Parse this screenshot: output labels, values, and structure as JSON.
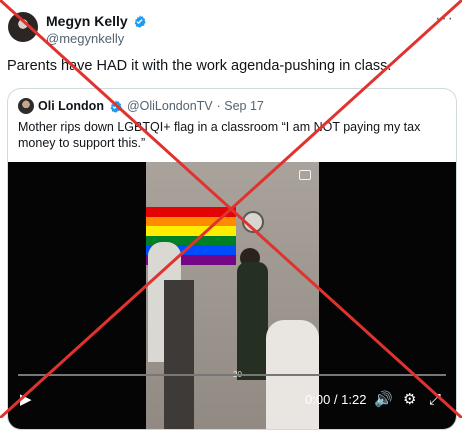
{
  "author": {
    "name": "Megyn Kelly",
    "handle": "@megynkelly"
  },
  "tweet_text": "Parents have HAD it with the work agenda-pushing in class.",
  "quoted": {
    "name": "Oli London",
    "handle": "@OliLondonTV",
    "date": "· Sep 17",
    "text": "Mother rips down LGBTQI+ flag in a classroom “I am NOT paying my tax money to support this.”"
  },
  "video": {
    "time": "0:00 / 1:22",
    "progress": 0,
    "watermark": "20"
  },
  "icons": {
    "more": "more-icon",
    "verified": "verified-badge-icon",
    "play": "play-icon",
    "volume": "volume-icon",
    "settings": "settings-icon",
    "fullscreen": "fullscreen-icon",
    "mini_player": "mini-player-icon"
  },
  "colors": {
    "verified": "#1d9bf0",
    "cross": "#e0332f"
  }
}
